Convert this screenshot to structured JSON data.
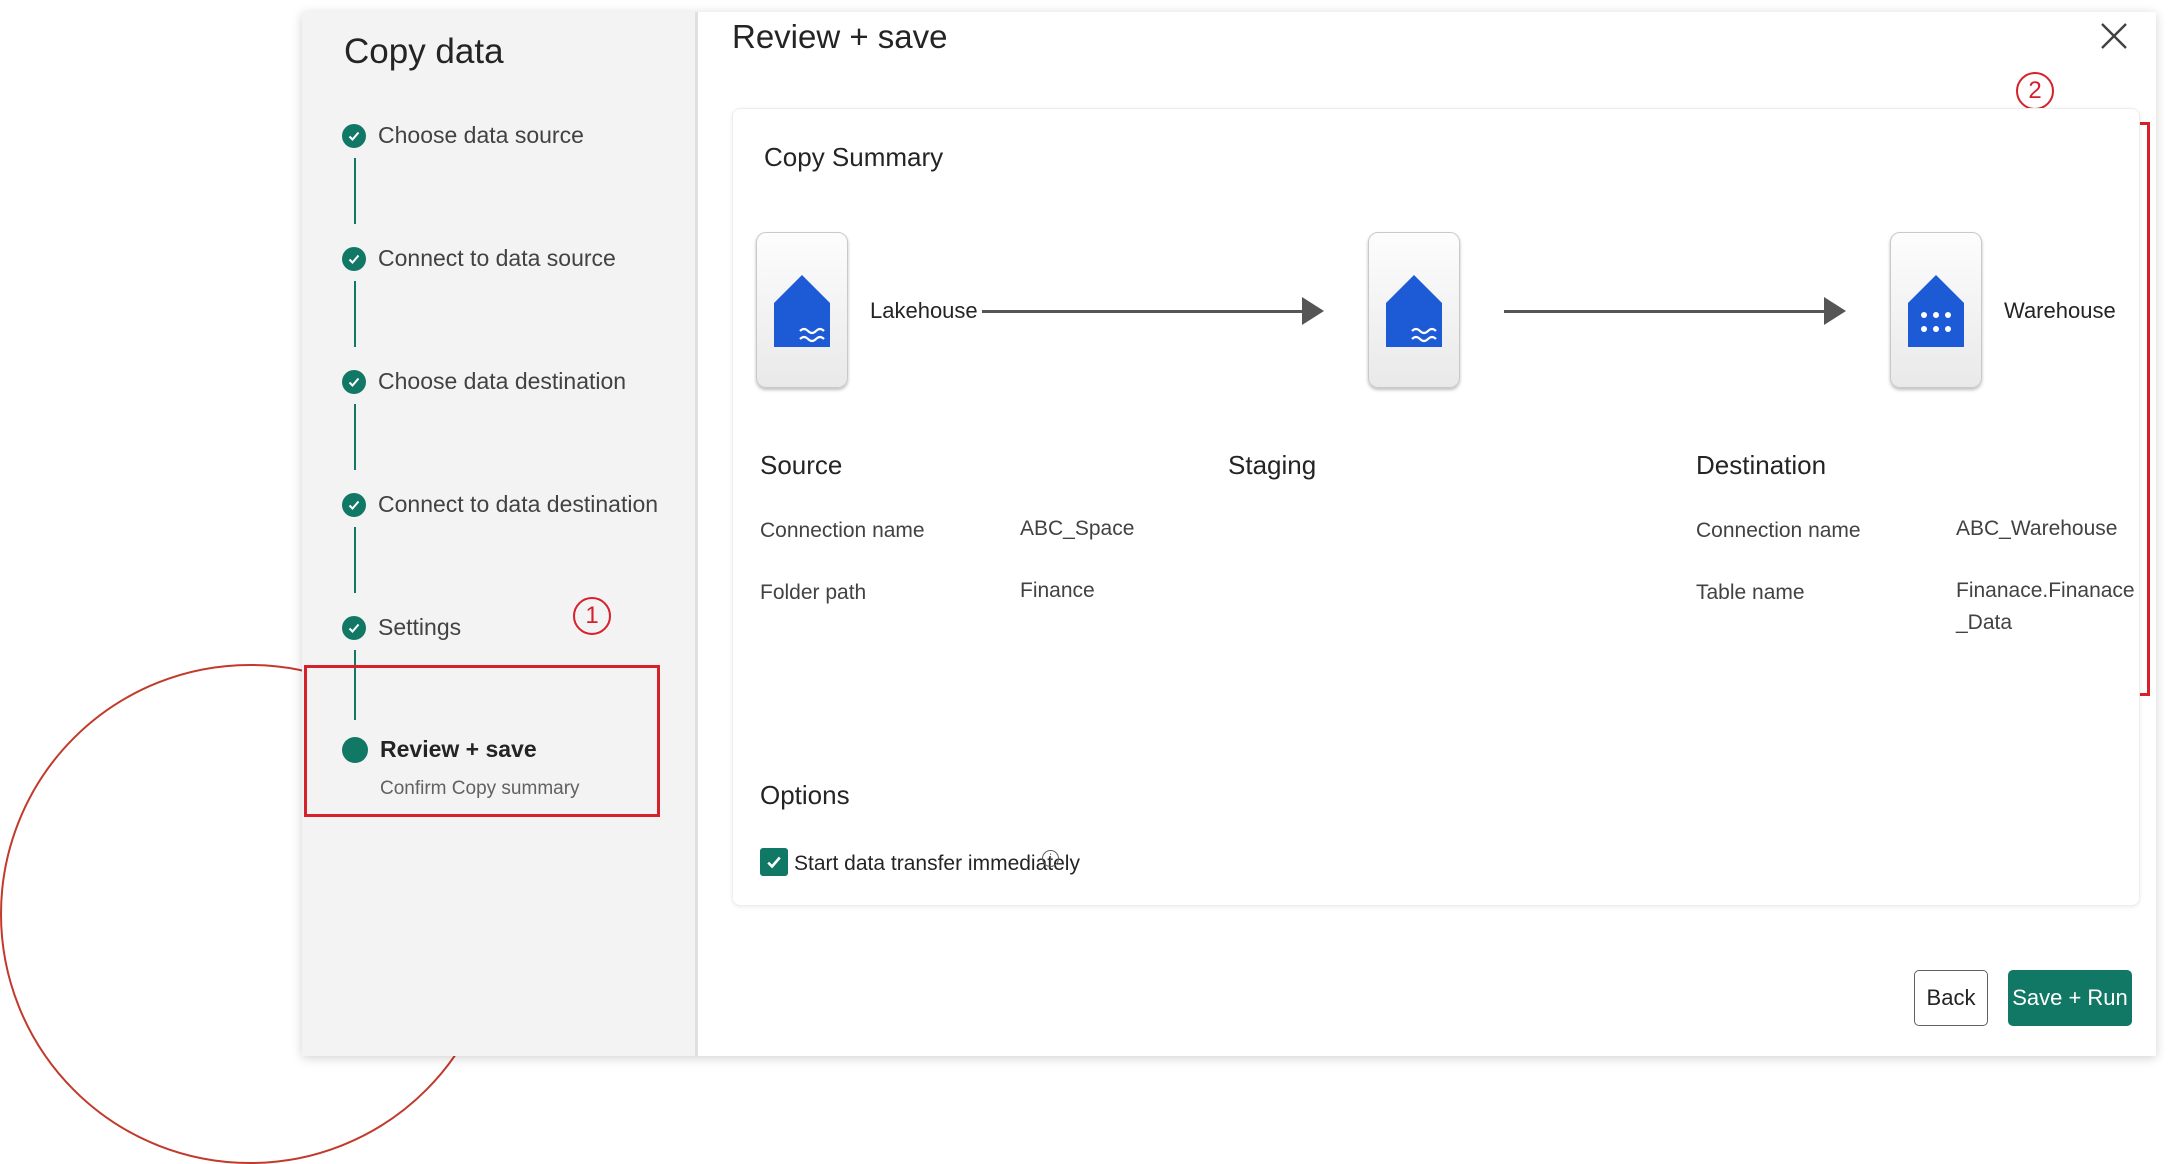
{
  "sidebar": {
    "title": "Copy data",
    "steps": [
      {
        "label": "Choose data source"
      },
      {
        "label": "Connect to data source"
      },
      {
        "label": "Choose data destination"
      },
      {
        "label": "Connect to data destination"
      },
      {
        "label": "Settings"
      }
    ],
    "current": {
      "label": "Review + save",
      "sublabel": "Confirm Copy summary"
    }
  },
  "annotations": {
    "badge1": "1",
    "badge2": "2"
  },
  "main": {
    "title": "Review + save",
    "summary": {
      "title": "Copy Summary",
      "nodes": {
        "source": "Lakehouse",
        "destination": "Warehouse"
      },
      "source": {
        "heading": "Source",
        "rows": [
          {
            "key": "Connection name",
            "value": "ABC_Space"
          },
          {
            "key": "Folder path",
            "value": "Finance"
          }
        ]
      },
      "staging": {
        "heading": "Staging"
      },
      "destination": {
        "heading": "Destination",
        "rows": [
          {
            "key": "Connection name",
            "value": "ABC_Warehouse"
          },
          {
            "key": "Table name",
            "value": "Finanace.Finanace_Data"
          }
        ]
      }
    },
    "options": {
      "title": "Options",
      "start_immediately_label": "Start data transfer immediately",
      "info_glyph": "i"
    },
    "buttons": {
      "back": "Back",
      "save_run": "Save + Run"
    }
  },
  "colors": {
    "accent": "#117865",
    "annotation": "#d6202a"
  },
  "icons": [
    "check-icon",
    "close-icon",
    "lakehouse-icon",
    "warehouse-icon",
    "info-icon"
  ]
}
